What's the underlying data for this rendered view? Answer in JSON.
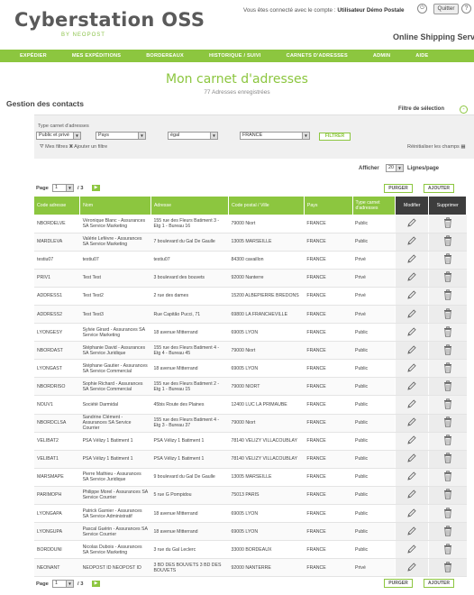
{
  "header": {
    "logo": "Cyberstation OSS",
    "logo_sub": "BY NEOPOST",
    "connected_text": "Vous êtes connecté avec le compte :",
    "connected_user": "Utilisateur Démo Postale",
    "quit_label": "Quitter",
    "help_glyph": "?",
    "power_glyph": "⏻",
    "service_title": "Online Shipping Services",
    "brand_color": "#8cc63f"
  },
  "nav": [
    "EXPÉDIER",
    "MES EXPÉDITIONS",
    "BORDEREAUX",
    "HISTORIQUE / SUIVI",
    "CARNETS D'ADRESSES",
    "ADMIN",
    "AIDE"
  ],
  "page": {
    "title": "Mon carnet d'adresses",
    "subtitle": "77 Adresses enregistrées",
    "section": "Gestion des contacts"
  },
  "filter": {
    "title": "Filtre de sélection",
    "toggle": "-",
    "type_label": "Type carnet d'adresses",
    "type_value": "Public et privé",
    "pays_value": "Pays",
    "egal_value": "égal",
    "country_value": "FRANCE",
    "filter_button": "FILTRER",
    "my_filters": "Mes filtres",
    "add_filter": "Ajouter un filtre",
    "reset": "Réinitialiser les champs"
  },
  "display": {
    "afficher_label": "Afficher",
    "lines_value": "20",
    "lines_label": "Lignes/page"
  },
  "pager": {
    "label": "Page",
    "current": "1",
    "total": "/ 3",
    "purge": "PURGER",
    "add": "AJOUTER"
  },
  "table": {
    "columns": [
      "Code adresse",
      "Nom",
      "Adresse",
      "Code postal / Ville",
      "Pays",
      "Type carnet d'adresses",
      "Modifier",
      "Supprimer"
    ],
    "rows": [
      {
        "code": "NBORDELVE",
        "nom": "Véronique Blanc - Assurances SA Service Marketing",
        "adresse": "155 rue des Fleurs Batiment 3 - Etg 1 - Bureau 16",
        "cp": "79000 Niort",
        "pays": "FRANCE",
        "type": "Public"
      },
      {
        "code": "MARDLEVA",
        "nom": "Valérie Lefèvre - Assurances SA Service Marketing",
        "adresse": "7 boulevard du Gal De Gaulle",
        "cp": "13005 MARSEILLE",
        "pays": "FRANCE",
        "type": "Public"
      },
      {
        "code": "testiu07",
        "nom": "testiu07",
        "adresse": "testiu07",
        "cp": "84300 cavaillon",
        "pays": "FRANCE",
        "type": "Privé"
      },
      {
        "code": "PRIV1",
        "nom": "Test Test",
        "adresse": "3 boulevard des bouvets",
        "cp": "92000 Nanterre",
        "pays": "FRANCE",
        "type": "Privé"
      },
      {
        "code": "ADDRESS1",
        "nom": "Test Test2",
        "adresse": "2 rue des dames",
        "cp": "15200 ALBEPIERRE BREDONS",
        "pays": "FRANCE",
        "type": "Privé"
      },
      {
        "code": "ADDRESS2",
        "nom": "Test Test3",
        "adresse": "Rue Capitão Pucci, 71",
        "cp": "69800 LA FRANCHEVILLE",
        "pays": "FRANCE",
        "type": "Privé"
      },
      {
        "code": "LYONGESY",
        "nom": "Sylvie Girard - Assurances SA Service Marketing",
        "adresse": "18 avenue Mitterrand",
        "cp": "69005 LYON",
        "pays": "FRANCE",
        "type": "Public"
      },
      {
        "code": "NBORDAST",
        "nom": "Stéphanie David - Assurances SA Service Juridique",
        "adresse": "155 rue des Fleurs Batiment 4 - Etg 4 - Bureau 45",
        "cp": "79000 Niort",
        "pays": "FRANCE",
        "type": "Public"
      },
      {
        "code": "LYONGAST",
        "nom": "Stéphane Gautier - Assurances SA Service Commercial",
        "adresse": "18 avenue Mitterrand",
        "cp": "69005 LYON",
        "pays": "FRANCE",
        "type": "Public"
      },
      {
        "code": "NBORDRISO",
        "nom": "Sophie Richard - Assurances SA Service Commercial",
        "adresse": "155 rue des Fleurs Batiment 2 - Etg 1 - Bureau 15",
        "cp": "79000 NIORT",
        "pays": "FRANCE",
        "type": "Public"
      },
      {
        "code": "NOUV1",
        "nom": "Société Darmidal",
        "adresse": "45bis Route des Plaines",
        "cp": "12400 LUC LA PRIMAUBE",
        "pays": "FRANCE",
        "type": "Public"
      },
      {
        "code": "NBORDCLSA",
        "nom": "Sandrine Clément - Assurances SA Service Courrier",
        "adresse": "155 rue des Fleurs Batiment 4 - Etg 3 - Bureau 37",
        "cp": "79000 Niort",
        "pays": "FRANCE",
        "type": "Public"
      },
      {
        "code": "VELIBAT2",
        "nom": "PSA Vélizy 1 Batiment 1",
        "adresse": "PSA Vélizy 1 Batiment 1",
        "cp": "78140 VELIZY VILLACOUBLAY",
        "pays": "FRANCE",
        "type": "Public"
      },
      {
        "code": "VELIBAT1",
        "nom": "PSA Vélizy 1 Batiment 1",
        "adresse": "PSA Vélizy 1 Batiment 1",
        "cp": "78140 VELIZY VILLACOUBLAY",
        "pays": "FRANCE",
        "type": "Public"
      },
      {
        "code": "MARSMAPE",
        "nom": "Pierre Mathieu - Assurances SA Service Juridique",
        "adresse": "9 boulevard du Gal De Gaulle",
        "cp": "13005 MARSEILLE",
        "pays": "FRANCE",
        "type": "Public"
      },
      {
        "code": "PARIMOPH",
        "nom": "Philippe Morel - Assurances SA Service Courrier",
        "adresse": "5 rue G Pompidou",
        "cp": "75013 PARIS",
        "pays": "FRANCE",
        "type": "Public"
      },
      {
        "code": "LYONGAPA",
        "nom": "Patrick Garnier - Assurances SA Service Administratif",
        "adresse": "18 avenue Mitterrand",
        "cp": "69005 LYON",
        "pays": "FRANCE",
        "type": "Public"
      },
      {
        "code": "LYONGUPA",
        "nom": "Pascal Guérin - Assurances SA Service Courrier",
        "adresse": "18 avenue Mitterrand",
        "cp": "69005 LYON",
        "pays": "FRANCE",
        "type": "Public"
      },
      {
        "code": "BORDDUNI",
        "nom": "Nicolas Dubois - Assurances SA Service Marketing",
        "adresse": "3 rue du Gal Leclerc",
        "cp": "33000 BORDEAUX",
        "pays": "FRANCE",
        "type": "Public"
      },
      {
        "code": "NEONANT",
        "nom": "NEOPOST ID NEOPOST ID",
        "adresse": "3 BD DES BOUVETS 3 BD DES BOUVETS",
        "cp": "92000 NANTERRE",
        "pays": "FRANCE",
        "type": "Privé"
      }
    ]
  }
}
